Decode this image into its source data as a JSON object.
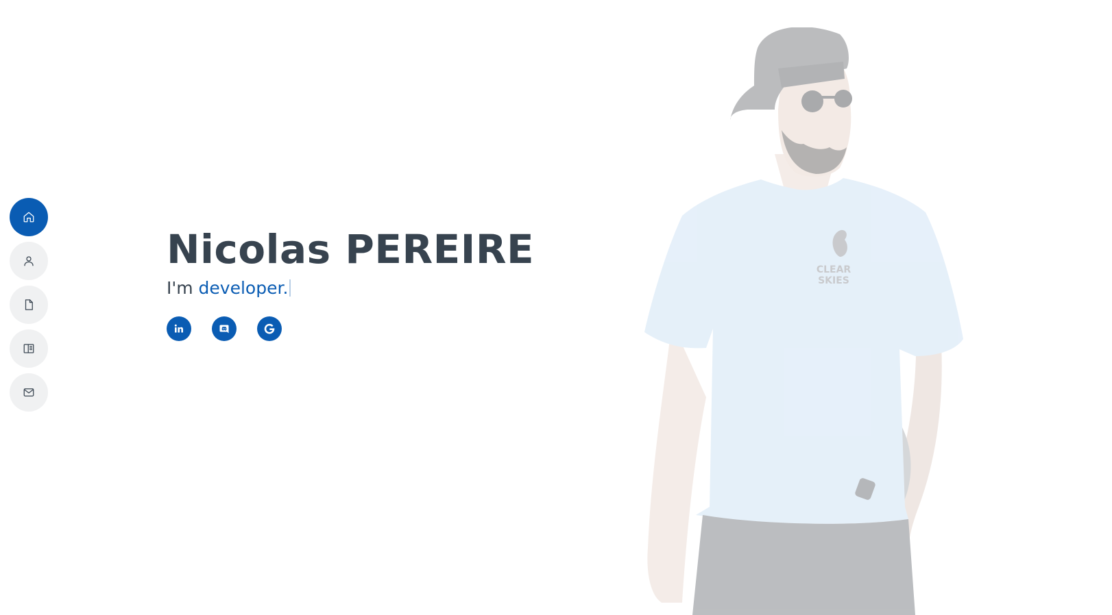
{
  "nav": {
    "items": [
      {
        "id": "home",
        "icon": "home-icon",
        "active": true
      },
      {
        "id": "about",
        "icon": "user-icon",
        "active": false
      },
      {
        "id": "resume",
        "icon": "file-icon",
        "active": false
      },
      {
        "id": "portfolio",
        "icon": "book-open-icon",
        "active": false
      },
      {
        "id": "contact",
        "icon": "mail-icon",
        "active": false
      }
    ]
  },
  "hero": {
    "name": "Nicolas PEREIRE",
    "intro": "I'm ",
    "role": "developer."
  },
  "socials": [
    {
      "id": "linkedin",
      "icon": "linkedin-icon"
    },
    {
      "id": "discord",
      "icon": "discord-icon"
    },
    {
      "id": "google",
      "icon": "google-icon"
    }
  ],
  "portrait": {
    "tshirt_print": [
      "CLEAR",
      "SKIES"
    ]
  },
  "colors": {
    "accent": "#0a5cb3",
    "text": "#37434f",
    "nav_bg": "#f0f1f2",
    "background": "#ffffff"
  }
}
